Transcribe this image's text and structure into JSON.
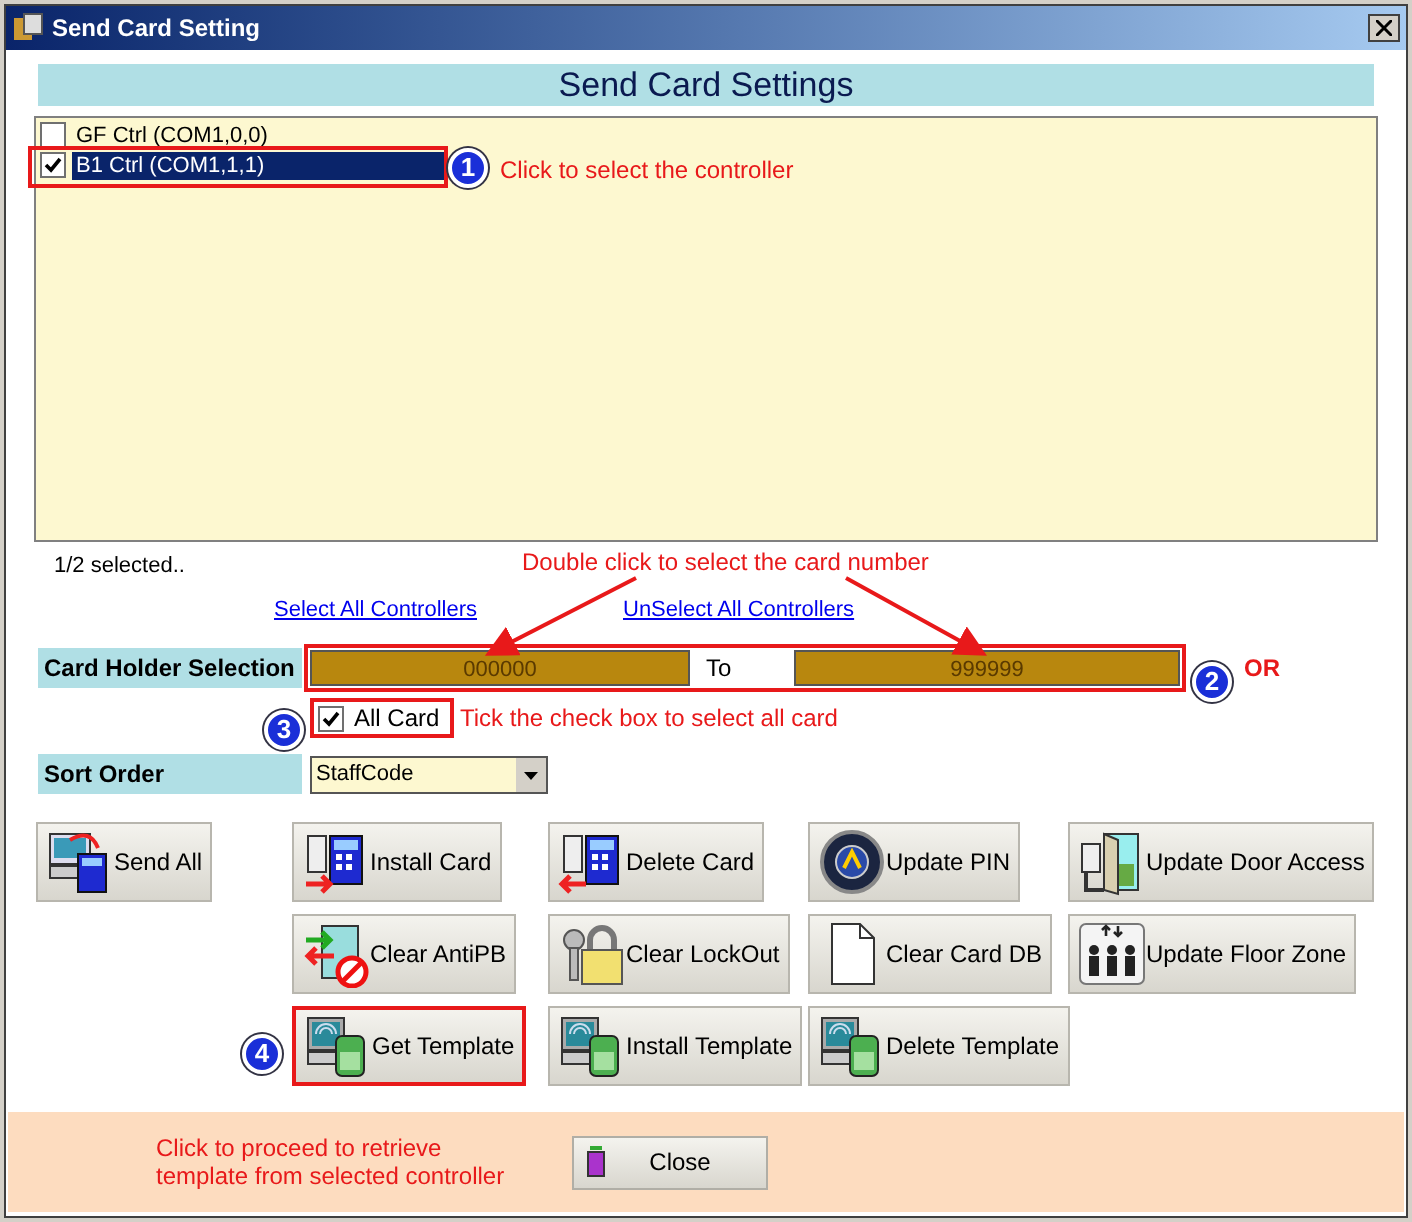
{
  "window": {
    "title": "Send Card Setting"
  },
  "header": "Send Card Settings",
  "controllers": [
    {
      "label": "GF Ctrl (COM1,0,0)",
      "checked": false,
      "selected": false
    },
    {
      "label": "B1 Ctrl (COM1,1,1)",
      "checked": true,
      "selected": true
    }
  ],
  "selection_count": "1/2 selected..",
  "links": [
    "Select All Controllers",
    "UnSelect All Controllers"
  ],
  "card_holder": {
    "label": "Card Holder Selection",
    "from": "000000",
    "to_label": "To",
    "to": "999999",
    "all_card": {
      "label": "All Card",
      "checked": true
    }
  },
  "sort_order": {
    "label": "Sort Order",
    "value": "StaffCode"
  },
  "button_rows": [
    [
      {
        "label": "Send All",
        "kind": "send",
        "highlighted": false
      },
      {
        "label": "Install Card",
        "kind": "install",
        "highlighted": false
      },
      {
        "label": "Delete Card",
        "kind": "delete",
        "highlighted": false
      },
      {
        "label": "Update PIN",
        "kind": "dial",
        "highlighted": false
      },
      {
        "label": "Update Door Access",
        "kind": "door",
        "highlighted": false
      }
    ],
    [
      {
        "label": "Clear AntiPB",
        "kind": "antipb",
        "highlighted": false
      },
      {
        "label": "Clear LockOut",
        "kind": "padlock",
        "highlighted": false
      },
      {
        "label": "Clear Card DB",
        "kind": "document",
        "highlighted": false
      },
      {
        "label": "Update Floor Zone",
        "kind": "people",
        "highlighted": false
      }
    ],
    [
      {
        "label": "Get Template",
        "kind": "reader",
        "highlighted": true
      },
      {
        "label": "Install Template",
        "kind": "reader",
        "highlighted": false
      },
      {
        "label": "Delete Template",
        "kind": "reader",
        "highlighted": false
      }
    ]
  ],
  "close_button": "Close",
  "annotations": {
    "controller": {
      "badge": "1",
      "note": "Click to select the controller"
    },
    "card_range": {
      "badge": "2",
      "note_above": "Double click to select the card number",
      "note_side": "OR"
    },
    "all_card": {
      "badge": "3",
      "note": "Tick the check box to select all card"
    },
    "template": {
      "badge": "4",
      "note": "Click to proceed to retrieve\ntemplate from selected controller"
    }
  }
}
